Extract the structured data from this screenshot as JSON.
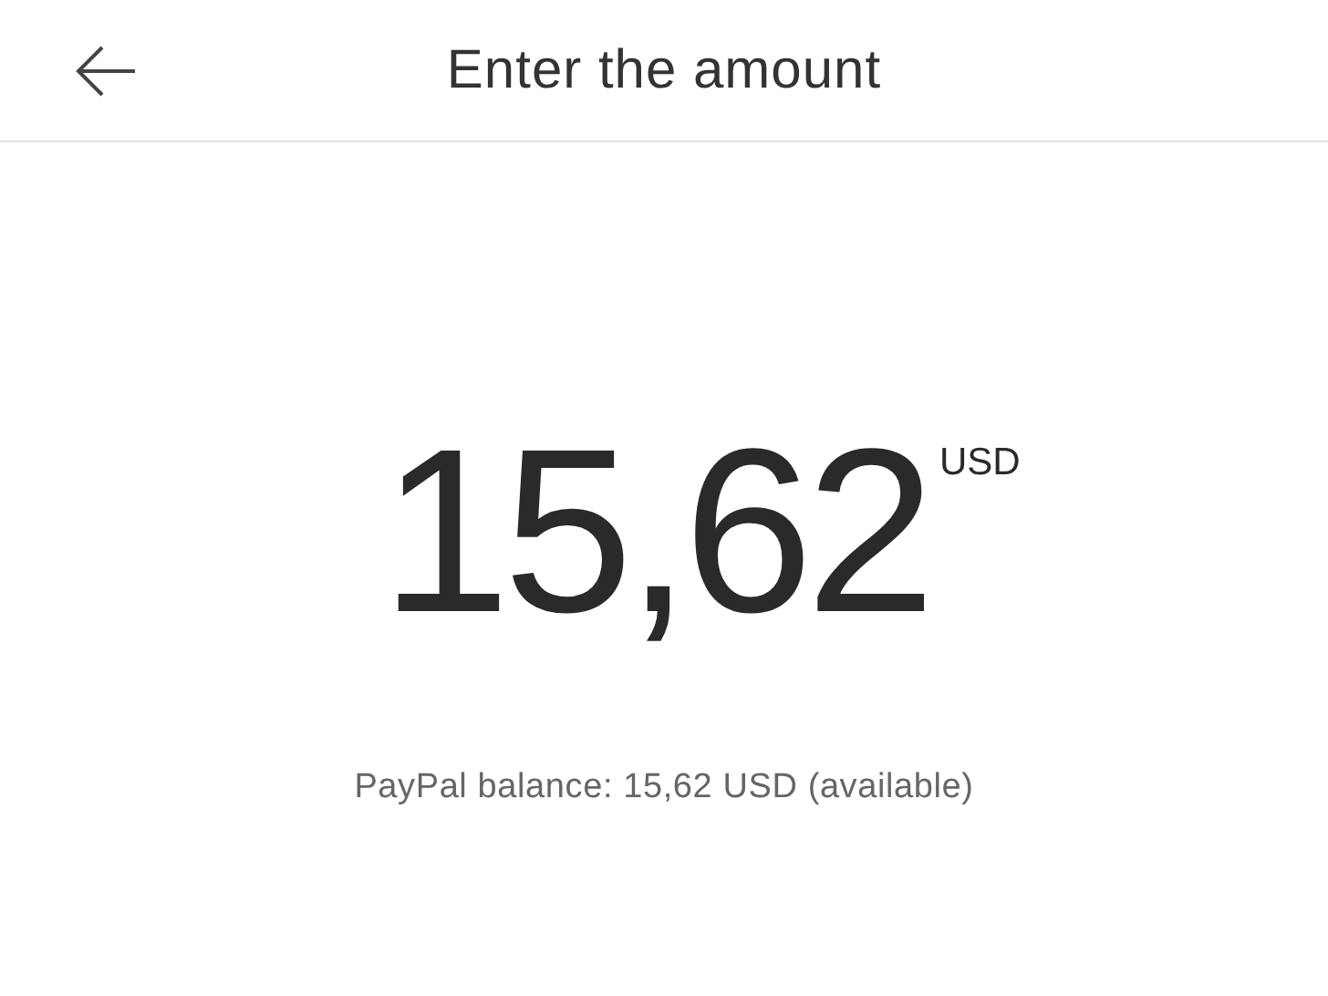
{
  "header": {
    "title": "Enter the amount"
  },
  "amount": {
    "value": "15,62",
    "currency": "USD"
  },
  "balance": "PayPal balance: 15,62 USD (available)"
}
